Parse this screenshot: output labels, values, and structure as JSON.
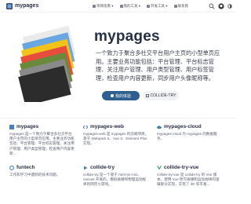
{
  "brand": "mypages",
  "nav": [
    {
      "label": "项目指南 ▾",
      "icon": "book-icon"
    },
    {
      "label": "我的工具 ▾",
      "icon": "tool-icon"
    },
    {
      "label": "开发工具 ▾",
      "icon": "dev-icon"
    },
    {
      "label": "联系我",
      "icon": "mail-icon"
    }
  ],
  "hero": {
    "title": "mypages",
    "description": "一个致力于聚合多社交平台用户主页的小型单页应用。主要业务功能包括：平台管理、平台标志管理、关注用户管理、用户类型管理、用户标签管理，检查用户内容更新，同步用户头像昵称等。",
    "primary_button": "我的体验",
    "secondary_button": "COLLIDE-TRY"
  },
  "cards": [
    {
      "title": "mypages",
      "description": "mypages 是一个致力于聚合多社交平台用户主页的小型单页应用。主要业务功能包括：平台管理、平台标志管理、关注用户管理、用户类型管理，检查用户内容更新..."
    },
    {
      "title": "mypages-web",
      "description": "mypages-web 是 mypages 的前端项目。基于 Webpack 5、Vue 3、Element Plus 实现。"
    },
    {
      "title": "mypages-cloud",
      "description": "mypages-cloud 为 mypages 的数据服务。"
    },
    {
      "title": "funtech",
      "description": "工作和学习中遇到的技术问题。"
    },
    {
      "title": "collide-try",
      "description": "collide-try 是一个基于 html+js+css、canvas 开发的，模拟碰撞和物理运动规律的网页小游戏。"
    },
    {
      "title": "collide-try-vue",
      "description": "collide-try-vue 是 collide-try 的 Vue 版本，使用 Vue 改写碰撞和运动规律的逻辑部分实现，实现了 3D 等丰富..."
    }
  ],
  "colors": {
    "primary": "#2f5f8f",
    "title": "#263045"
  }
}
